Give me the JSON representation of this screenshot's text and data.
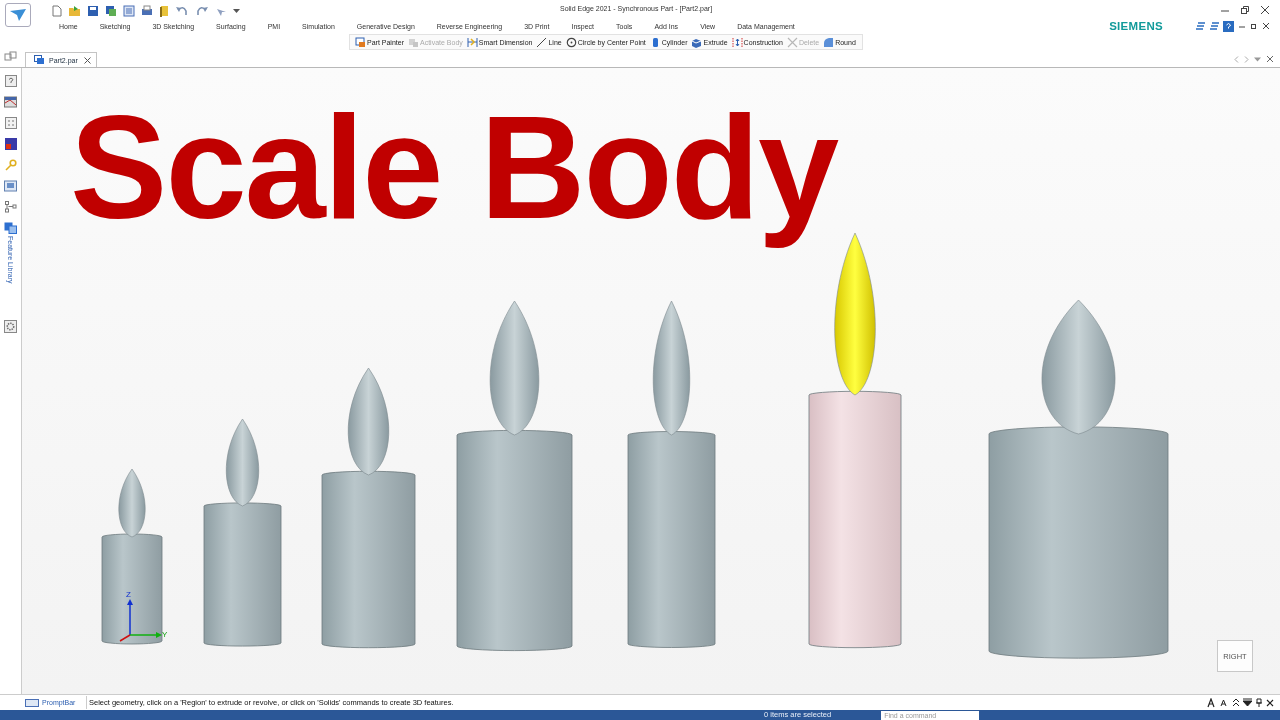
{
  "window": {
    "title": "Solid Edge 2021 - Synchronous Part - [Part2.par]"
  },
  "ribbon": {
    "tabs": [
      "Home",
      "Sketching",
      "3D Sketching",
      "Surfacing",
      "PMI",
      "Simulation",
      "Generative Design",
      "Reverse Engineering",
      "3D Print",
      "Inspect",
      "Tools",
      "Add Ins",
      "View",
      "Data Management"
    ],
    "brand": "SIEMENS"
  },
  "command_bar": [
    {
      "label": "Part Painter",
      "kind": "painter",
      "disabled": false
    },
    {
      "label": "Activate Body",
      "kind": "activate",
      "disabled": true
    },
    {
      "label": "Smart Dimension",
      "kind": "dimension",
      "disabled": false
    },
    {
      "label": "Line",
      "kind": "line",
      "disabled": false
    },
    {
      "label": "Circle by Center Point",
      "kind": "circle",
      "disabled": false
    },
    {
      "label": "Cylinder",
      "kind": "cylinder",
      "disabled": false
    },
    {
      "label": "Extrude",
      "kind": "extrude",
      "disabled": false
    },
    {
      "label": "Construction",
      "kind": "construction",
      "disabled": false
    },
    {
      "label": "Delete",
      "kind": "delete",
      "disabled": true
    },
    {
      "label": "Round",
      "kind": "round",
      "disabled": false
    }
  ],
  "document_tabs": [
    {
      "label": "Part2.par",
      "selected": true
    }
  ],
  "side_panel": {
    "label": "Feature Library"
  },
  "viewport": {
    "overlay_title": "Scale Body",
    "bodies": [
      {
        "selected": false
      },
      {
        "selected": false
      },
      {
        "selected": false
      },
      {
        "selected": false
      },
      {
        "selected": false
      },
      {
        "selected": true
      },
      {
        "selected": false
      }
    ],
    "triad": {
      "z": "Z",
      "y": "Y"
    },
    "view_cube": "RIGHT"
  },
  "prompt_bar": {
    "label": "PromptBar",
    "message": "Select geometry, click on a 'Region' to extrude or revolve, or click on 'Solids' commands to create 3D features."
  },
  "status_bar": {
    "text": "0 items are selected",
    "search": {
      "placeholder": "Find a command"
    }
  }
}
